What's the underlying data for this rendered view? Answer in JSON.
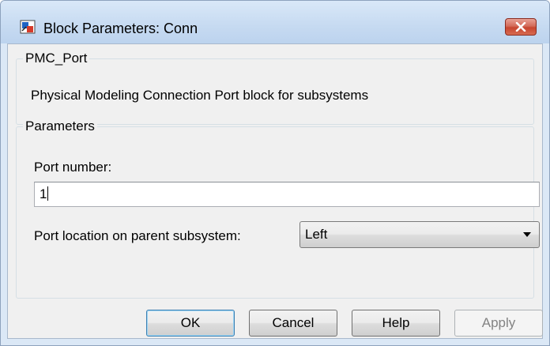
{
  "window": {
    "title": "Block Parameters: Conn",
    "icon": "simulink-block-icon",
    "close_icon": "close-icon"
  },
  "block": {
    "name": "PMC_Port",
    "description": "Physical Modeling Connection Port block for subsystems"
  },
  "parameters": {
    "legend": "Parameters",
    "port_number_label": "Port number:",
    "port_number_value": "1",
    "location_label": "Port location on parent subsystem:",
    "location_value": "Left"
  },
  "buttons": {
    "ok": "OK",
    "cancel": "Cancel",
    "help": "Help",
    "apply": "Apply"
  },
  "colors": {
    "close_button": "#c7452f",
    "default_button_border": "#3c7fb1",
    "disabled_text": "#838383"
  }
}
